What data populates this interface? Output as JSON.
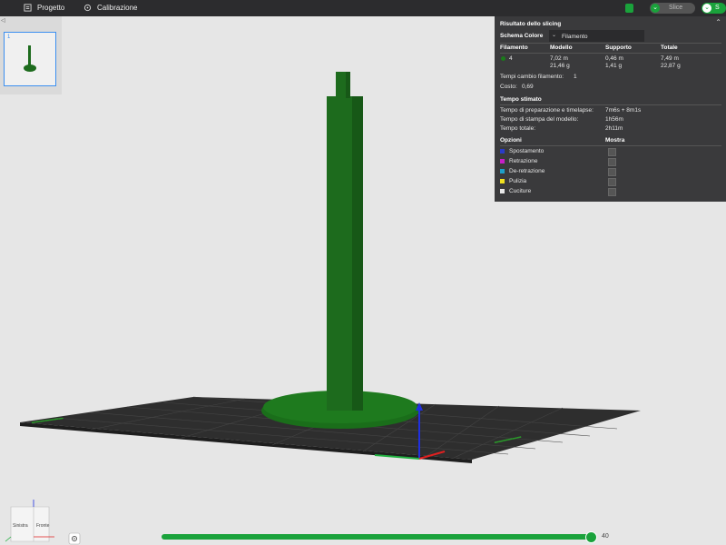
{
  "topbar": {
    "project_label": "Progetto",
    "calibration_label": "Calibrazione",
    "slice_label": "Slice",
    "send_label": "S"
  },
  "left_panel": {
    "thumb_number": "1",
    "collapse_label": "◁"
  },
  "result_panel": {
    "title": "Risultato dello slicing",
    "color_scheme_label": "Schema Colore",
    "color_scheme_value": "Filamento",
    "columns": [
      "Filamento",
      "Modello",
      "Supporto",
      "Totale"
    ],
    "filament_row": {
      "id": "4",
      "color": "#1b7a1b",
      "model_m": "7,02 m",
      "model_g": "21,46 g",
      "support_m": "0,46 m",
      "support_g": "1,41 g",
      "total_m": "7,49 m",
      "total_g": "22,87 g"
    },
    "filament_change_label": "Tempi cambio filamento:",
    "filament_change_value": "1",
    "cost_label": "Costo:",
    "cost_value": "0,69",
    "time_title": "Tempo stimato",
    "prep_label": "Tempo di preparazione e timelapse:",
    "prep_value": "7m6s + 8m1s",
    "print_label": "Tempo di stampa del modello:",
    "print_value": "1h56m",
    "total_label": "Tempo totale:",
    "total_value": "2h11m",
    "options_label": "Opzioni",
    "show_label": "Mostra",
    "options": [
      {
        "label": "Spostamento",
        "color": "#2a3cc8"
      },
      {
        "label": "Retrazione",
        "color": "#c81fc8"
      },
      {
        "label": "De-retrazione",
        "color": "#1fa0c8"
      },
      {
        "label": "Pulizia",
        "color": "#f0e020"
      },
      {
        "label": "Cuciture",
        "color": "#e8e8e8"
      }
    ]
  },
  "view_cube": {
    "left_face": "Sinistra",
    "front_face": "Fronte"
  },
  "layer_slider": {
    "value": "40"
  },
  "colors": {
    "model": "#1b6b1b",
    "accent": "#1aa23b",
    "plate": "#2e2e2e"
  }
}
